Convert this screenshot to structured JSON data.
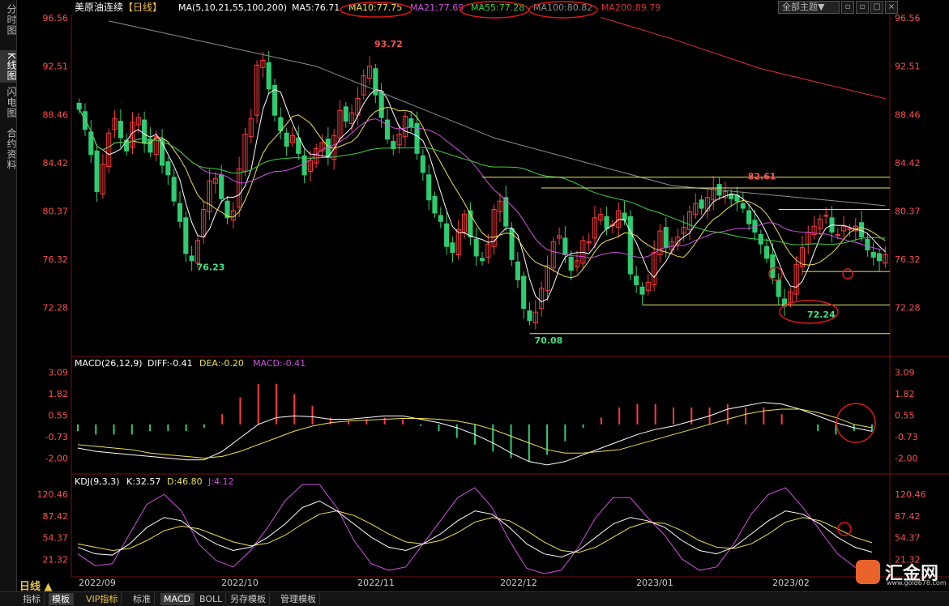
{
  "sidebar": {
    "tabs": [
      "分时图",
      "K线图",
      "闪电图",
      "合约资料"
    ]
  },
  "header": {
    "symbol": "美原油连续",
    "period": "【日线】",
    "ma_params": "MA(5,10,21,55,100,200)",
    "ma": [
      {
        "label": "MA5:76.71",
        "color": "#ffffff"
      },
      {
        "label": "MA10:77.75",
        "color": "#f0e050"
      },
      {
        "label": "MA21:77.69",
        "color": "#d050e0"
      },
      {
        "label": "MA55:77.28",
        "color": "#40d040"
      },
      {
        "label": "MA100:80.82",
        "color": "#909090"
      },
      {
        "label": "MA200:89.79",
        "color": "#e03030"
      }
    ],
    "theme": "全部主题▼",
    "win_buttons": [
      "▫",
      "▫",
      "□",
      "×"
    ]
  },
  "price_axis": {
    "ticks": [
      "96.56",
      "92.51",
      "88.46",
      "84.42",
      "80.37",
      "76.32",
      "72.28"
    ]
  },
  "macd_axis": {
    "ticks": [
      "3.09",
      "1.82",
      "0.55",
      "-0.73",
      "-2.00"
    ]
  },
  "kdj_axis": {
    "ticks": [
      "120.46",
      "87.42",
      "54.37",
      "21.32"
    ]
  },
  "macd_header": {
    "title": "MACD(26,12,9)",
    "diff": "DIFF:-0.41",
    "dea": "DEA:-0.20",
    "macd": "MACD:-0.41"
  },
  "kdj_header": {
    "title": "KDJ(9,3,3)",
    "k": "K:32.57",
    "d": "D:46.80",
    "j": "J:4.12"
  },
  "date_axis": [
    "2022/09",
    "2022/10",
    "2022/11",
    "2022/12",
    "2023/01",
    "2023/02"
  ],
  "period_button": "日线 ▲",
  "bottom_tabs": [
    "指标",
    "模板",
    "VIP指标",
    "标准",
    "MACD",
    "BOLL",
    "另存模板",
    "管理模板"
  ],
  "logo": {
    "name": "汇金网",
    "url": "www.gold678.com"
  },
  "colors": {
    "up": "#ff3b3b",
    "down": "#2ecc71",
    "text_red": "#ff5050",
    "text_green": "#40e080"
  },
  "chart_data": {
    "type": "candlestick",
    "ylim": [
      70.08,
      96.56
    ],
    "annotations": [
      {
        "text": "93.72",
        "value": 93.72,
        "kind": "high"
      },
      {
        "text": "76.23",
        "value": 76.23,
        "kind": "low"
      },
      {
        "text": "70.08",
        "value": 70.08,
        "kind": "low"
      },
      {
        "text": "82.61",
        "value": 82.61,
        "kind": "high"
      },
      {
        "text": "72.24",
        "value": 72.24,
        "kind": "low"
      }
    ],
    "horizontal_levels": [
      83.2,
      82.3,
      80.5,
      75.3,
      72.5,
      70.1
    ],
    "close": [
      88.9,
      87.2,
      85.1,
      82.0,
      84.3,
      86.9,
      88.1,
      86.5,
      85.4,
      87.8,
      88.2,
      86.1,
      85.3,
      86.6,
      84.2,
      83.4,
      81.2,
      79.5,
      76.8,
      76.2,
      77.9,
      80.5,
      82.9,
      83.1,
      81.4,
      79.8,
      80.4,
      83.9,
      86.8,
      88.1,
      92.6,
      93.0,
      90.6,
      88.4,
      87.1,
      85.8,
      86.7,
      85.2,
      83.4,
      84.6,
      85.6,
      86.1,
      84.9,
      86.7,
      88.8,
      87.9,
      88.6,
      89.8,
      91.7,
      92.5,
      90.1,
      88.2,
      86.4,
      85.6,
      86.8,
      88.3,
      87.4,
      85.2,
      83.6,
      81.3,
      80.2,
      79.5,
      77.4,
      76.9,
      78.8,
      80.1,
      78.2,
      76.6,
      76.2,
      77.6,
      80.5,
      81.2,
      79.1,
      76.3,
      74.6,
      72.2,
      71.2,
      71.9,
      73.9,
      75.8,
      77.8,
      78.3,
      76.7,
      75.4,
      76.2,
      77.9,
      77.8,
      79.8,
      80.1,
      78.9,
      79.2,
      80.4,
      79.6,
      75.1,
      74.2,
      73.4,
      74.4,
      76.9,
      78.7,
      77.3,
      77.8,
      78.2,
      79.0,
      80.3,
      81.0,
      80.6,
      81.5,
      82.3,
      81.7,
      82.0,
      81.4,
      81.2,
      80.6,
      79.3,
      78.6,
      77.6,
      76.4,
      74.8,
      73.2,
      72.4,
      73.6,
      75.9,
      77.3,
      78.6,
      79.1,
      79.7,
      80.0,
      78.6,
      78.4,
      79.1,
      78.9,
      79.1,
      78.2,
      77.1,
      76.5,
      76.2,
      76.71
    ],
    "macd": {
      "diff": [
        -1.4,
        -1.6,
        -1.7,
        -1.8,
        -1.9,
        -2.0,
        -2.1,
        -2.1,
        -1.6,
        -0.8,
        0.0,
        0.4,
        0.5,
        0.45,
        0.3,
        0.3,
        0.4,
        0.5,
        0.5,
        0.3,
        0.1,
        -0.2,
        -0.6,
        -1.1,
        -1.7,
        -2.2,
        -2.4,
        -2.2,
        -1.8,
        -1.4,
        -1.0,
        -0.6,
        -0.3,
        -0.1,
        0.2,
        0.5,
        0.9,
        1.1,
        1.3,
        1.2,
        0.9,
        0.5,
        0.1,
        -0.2,
        -0.41
      ],
      "dea": [
        -1.2,
        -1.3,
        -1.4,
        -1.5,
        -1.7,
        -1.8,
        -1.9,
        -2.0,
        -1.9,
        -1.6,
        -1.2,
        -0.8,
        -0.4,
        -0.1,
        0.1,
        0.2,
        0.25,
        0.3,
        0.35,
        0.35,
        0.3,
        0.2,
        0.0,
        -0.3,
        -0.7,
        -1.1,
        -1.5,
        -1.7,
        -1.7,
        -1.6,
        -1.5,
        -1.2,
        -0.9,
        -0.6,
        -0.3,
        0.0,
        0.3,
        0.6,
        0.8,
        0.9,
        0.9,
        0.7,
        0.4,
        0.0,
        -0.2
      ]
    },
    "kdj": {
      "k": [
        40,
        30,
        28,
        45,
        70,
        85,
        80,
        60,
        45,
        35,
        40,
        55,
        75,
        100,
        110,
        95,
        75,
        55,
        40,
        35,
        45,
        60,
        80,
        95,
        90,
        70,
        45,
        30,
        25,
        35,
        55,
        75,
        85,
        80,
        70,
        50,
        35,
        30,
        40,
        60,
        80,
        95,
        90,
        75,
        55,
        40,
        32.57
      ],
      "d": [
        45,
        40,
        35,
        38,
        50,
        65,
        72,
        68,
        58,
        48,
        42,
        46,
        58,
        75,
        90,
        95,
        88,
        75,
        60,
        48,
        45,
        50,
        62,
        78,
        85,
        80,
        65,
        48,
        35,
        32,
        40,
        55,
        70,
        78,
        76,
        65,
        50,
        40,
        38,
        45,
        60,
        78,
        85,
        80,
        68,
        55,
        46.8
      ],
      "j": [
        30,
        12,
        15,
        60,
        105,
        120,
        95,
        45,
        20,
        10,
        35,
        70,
        110,
        140,
        150,
        100,
        50,
        15,
        5,
        10,
        45,
        80,
        115,
        130,
        100,
        50,
        8,
        -5,
        5,
        40,
        85,
        115,
        115,
        85,
        58,
        22,
        5,
        10,
        45,
        90,
        120,
        130,
        100,
        65,
        30,
        10,
        4.12
      ]
    }
  }
}
